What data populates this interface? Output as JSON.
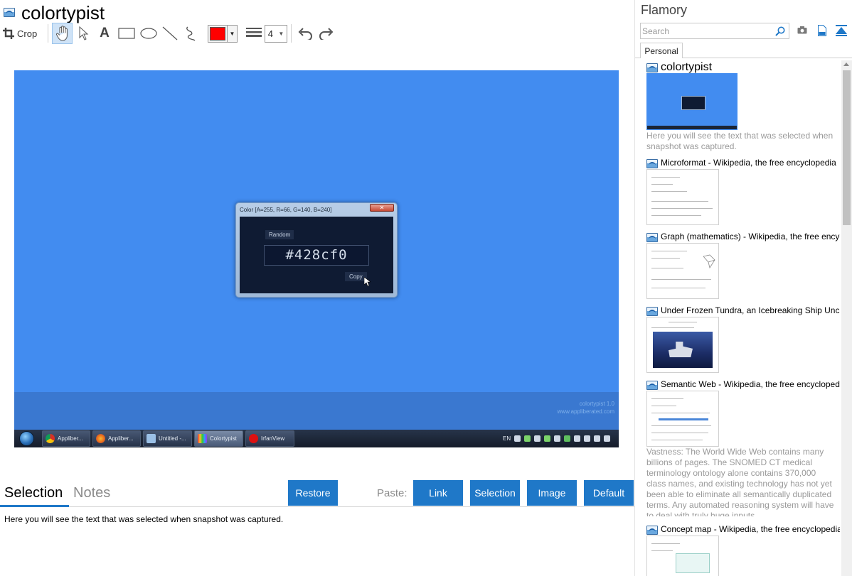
{
  "header": {
    "title": "colortypist"
  },
  "toolbar": {
    "crop_label": "Crop",
    "text_tool_glyph": "A",
    "color": "#ff0000",
    "line_width": "4"
  },
  "snapshot": {
    "background": "#428cf0",
    "window_title": "Color [A=255, R=66, G=140, B=240]",
    "random_label": "Random",
    "hex_value": "#428cf0",
    "copy_label": "Copy",
    "watermark_line1": "colortypist 1.0",
    "watermark_line2": "www.appliberated.com",
    "taskbar_items": [
      "Appliber...",
      "Appliber...",
      "Untitled -...",
      "Colortypist",
      "IrfanView"
    ],
    "tray_lang": "EN"
  },
  "tabs": {
    "selection": "Selection",
    "notes": "Notes"
  },
  "buttons": {
    "restore": "Restore",
    "paste_label": "Paste:",
    "link": "Link",
    "selection": "Selection",
    "image": "Image",
    "default": "Default"
  },
  "selection_text": "Here you will see the text that was selected when snapshot was captured.",
  "sidebar": {
    "app_name": "Flamory",
    "search_placeholder": "Search",
    "tab_personal": "Personal",
    "items": [
      {
        "title": "colortypist",
        "description": "Here you will see the text that was selected when snapshot was captured."
      },
      {
        "title": "Microformat - Wikipedia, the free encyclopedia"
      },
      {
        "title": "Graph (mathematics) - Wikipedia, the free encyclopedia"
      },
      {
        "title": "Under Frozen Tundra, an Icebreaking Ship Uncovers"
      },
      {
        "title": "Semantic Web - Wikipedia, the free encyclopedia",
        "description": "Vastness: The World Wide Web contains many billions of pages. The SNOMED CT medical terminology ontology alone contains 370,000 class names, and existing technology has not yet been able to eliminate all semantically duplicated terms. Any automated reasoning system will have to deal with truly huge inputs."
      },
      {
        "title": "Concept map - Wikipedia, the free encyclopedia"
      }
    ]
  },
  "colors": {
    "accent": "#1f78c8",
    "snapshot_blue": "#428cf0",
    "muted_text": "#9a9a9a"
  },
  "icons": [
    "crop-icon",
    "hand-icon",
    "pointer-icon",
    "text-icon",
    "rectangle-icon",
    "ellipse-icon",
    "line-icon",
    "freehand-icon",
    "line-width-icon",
    "undo-icon",
    "redo-icon",
    "search-icon",
    "camera-icon",
    "page-icon",
    "collapse-icon"
  ]
}
